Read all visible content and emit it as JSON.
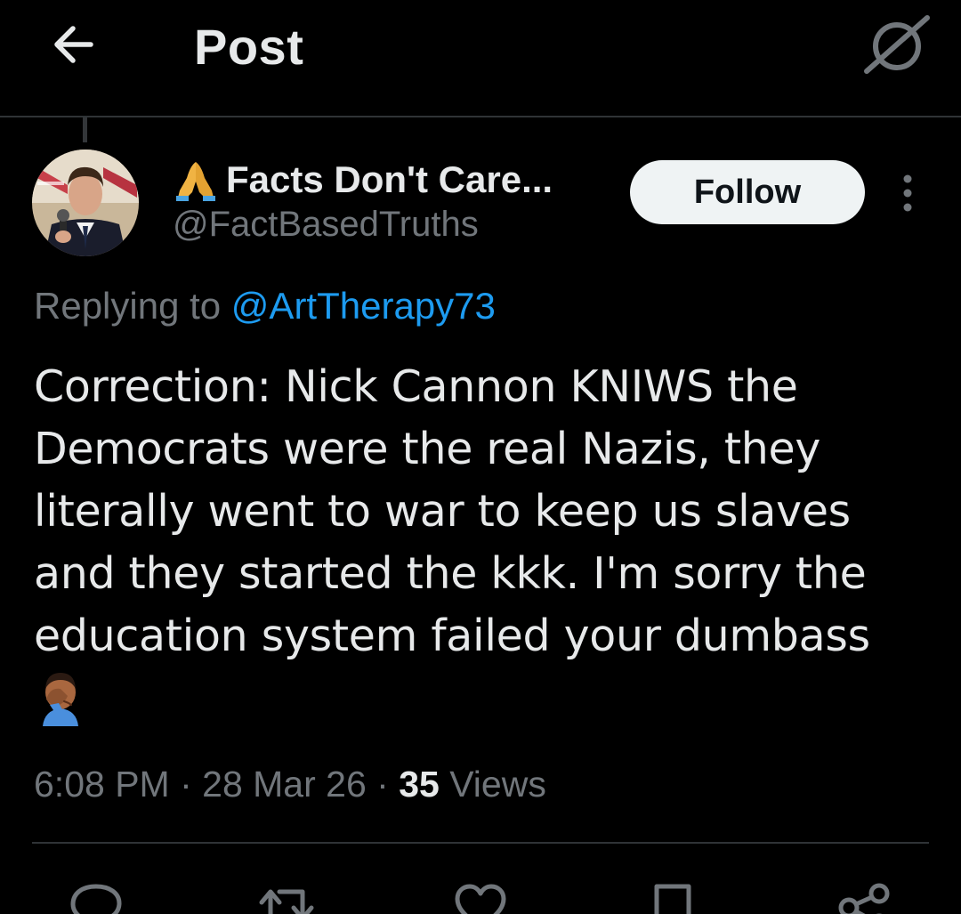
{
  "header": {
    "title": "Post"
  },
  "tweet": {
    "author_name": "Facts Don't Care...",
    "author_handle": "@FactBasedTruths",
    "follow_label": "Follow",
    "replying_prefix": "Replying to",
    "replying_to": "@ArtTherapy73",
    "text": "Correction: Nick Cannon KNIWS the\nDemocrats were the real Nazis, they\nliterally went to war to keep us slaves\nand they started the kkk. I'm sorry the\neducation system failed your dumbass",
    "time": "6:08 PM",
    "separator": " · ",
    "date": "28 Mar 26",
    "views_count": "35",
    "views_label": "Views"
  },
  "icons": {
    "back": "arrow-left-icon",
    "grok": "grok-icon",
    "more": "more-vertical-icon",
    "name_emoji": "folded-hands-icon",
    "text_emoji": "facepalm-icon",
    "reply": "reply-icon",
    "repost": "repost-icon",
    "like": "like-icon",
    "bookmark": "bookmark-icon",
    "share": "share-icon"
  },
  "colors": {
    "background": "#000000",
    "text_primary": "#e7e9ea",
    "text_secondary": "#71767b",
    "link": "#1d9bf0",
    "divider": "#2f3336",
    "follow_bg": "#eff3f4",
    "follow_text": "#0f1419"
  }
}
